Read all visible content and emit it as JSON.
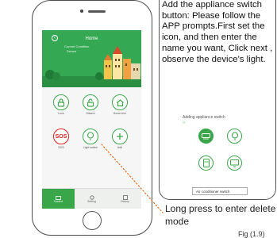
{
  "phone": {
    "screen_title": "Home",
    "condition_label": "Current Condition",
    "condition_value": "Dream",
    "tiles": [
      {
        "label": "Lock",
        "icon": "lock-icon"
      },
      {
        "label": "Disarm",
        "icon": "unlock-icon"
      },
      {
        "label": "Home Arm",
        "icon": "home-icon"
      },
      {
        "label": "SOS",
        "icon": "sos-icon"
      },
      {
        "label": "Light switch",
        "icon": "lightbulb-icon"
      },
      {
        "label": "Add",
        "icon": "plus-icon"
      }
    ],
    "tabs": [
      {
        "label": "Control",
        "active": true
      },
      {
        "label": "Setting",
        "active": false
      },
      {
        "label": "History",
        "active": false
      }
    ],
    "sos_color": "#e02020",
    "accent_color": "#3aa64a"
  },
  "instructions": {
    "text": "Add the appliance switch button: Please follow the APP prompts.First set the icon, and then enter the name you want, Click  next , observe the device's light."
  },
  "inner_phone": {
    "title": "Adding appliance switch",
    "icons": [
      "air-conditioner-icon",
      "lightbulb-icon",
      "refrigerator-icon",
      "monitor-icon"
    ],
    "input_value": "Air conditioner switch"
  },
  "callout": {
    "text": "Long press to enter delete mode"
  },
  "figure_label": "Fig (1.9)"
}
